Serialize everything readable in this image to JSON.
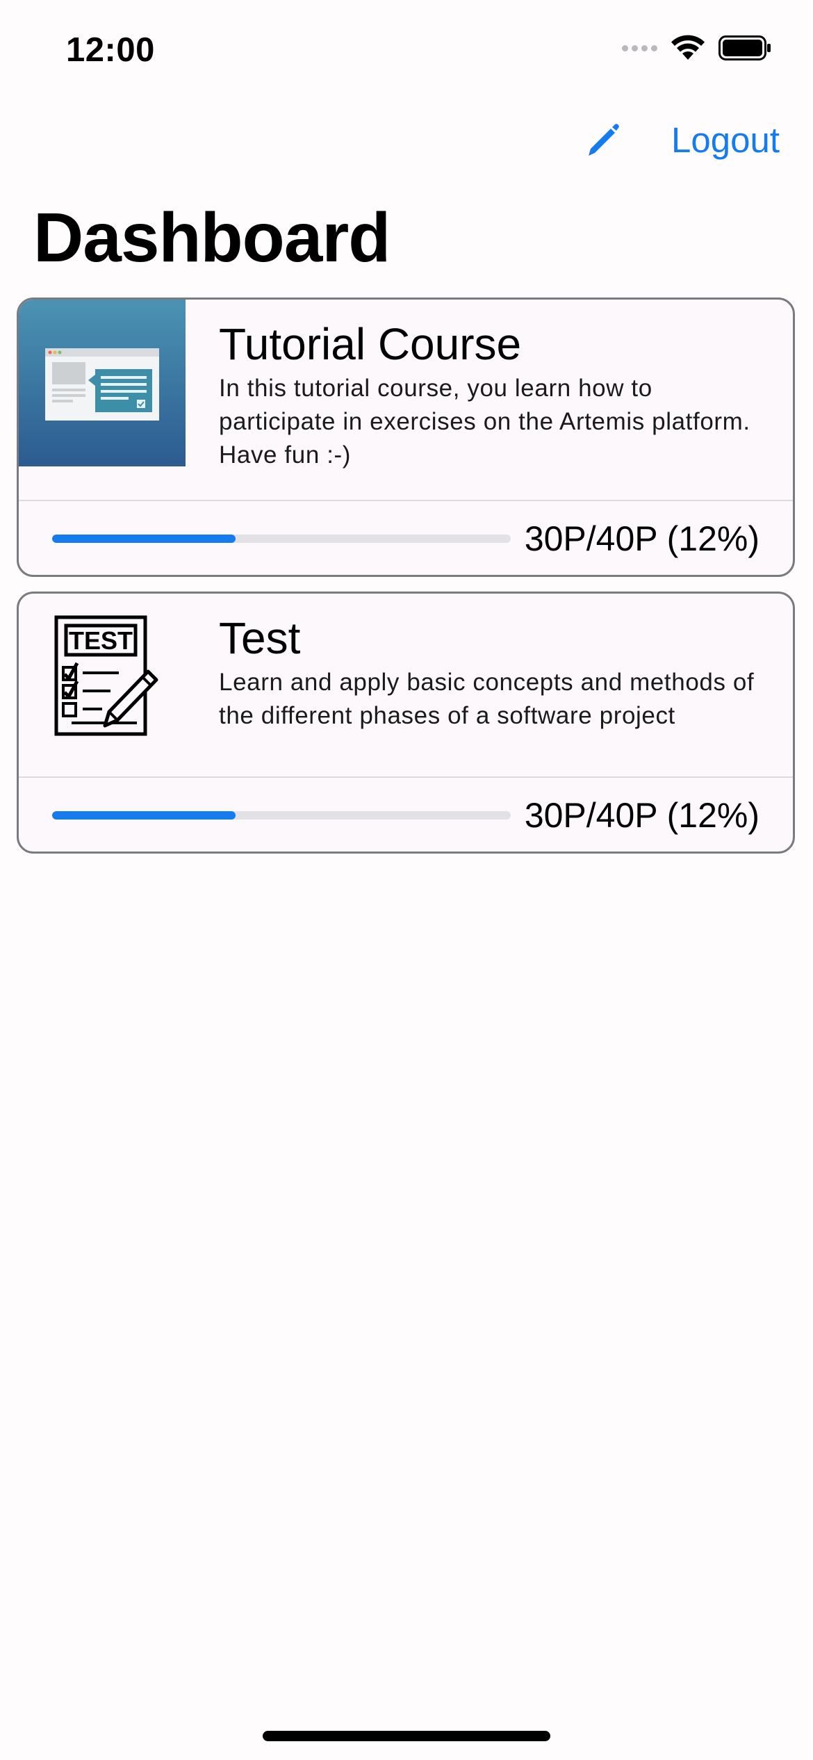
{
  "status_bar": {
    "time": "12:00"
  },
  "nav": {
    "edit_icon": "pencil-icon",
    "logout_label": "Logout"
  },
  "page": {
    "title": "Dashboard"
  },
  "colors": {
    "accent": "#157cf0",
    "background": "#fffcfe",
    "card_background": "#fdf8fc",
    "card_border": "#7a7a80",
    "track": "#e2e2e6"
  },
  "courses": [
    {
      "title": "Tutorial Course",
      "description": "In this tutorial course, you learn how to participate in exercises on the Artemis platform. Have fun :-)",
      "image_icon": "tutorial-course-image",
      "progress_label": "30P/40P (12%)",
      "progress_fraction": 0.4
    },
    {
      "title": "Test",
      "description": "Learn and apply basic concepts and methods of the different phases of a software project",
      "image_icon": "test-checklist-icon",
      "image_text": "TEST",
      "progress_label": "30P/40P (12%)",
      "progress_fraction": 0.4
    }
  ]
}
